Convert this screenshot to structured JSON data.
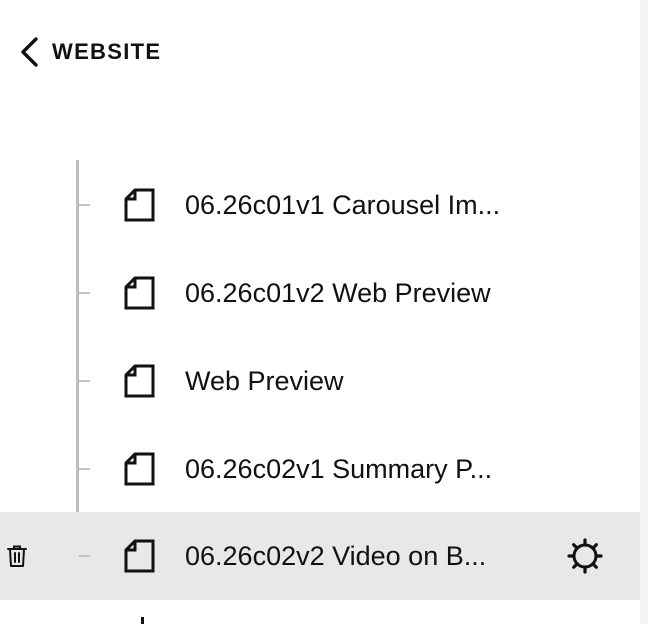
{
  "header": {
    "back_label": "WEBSITE"
  },
  "pages": [
    {
      "label": "06.26c01v1 Carousel Im..."
    },
    {
      "label": "06.26c01v2 Web Preview"
    },
    {
      "label": "Web Preview"
    },
    {
      "label": "06.26c02v1 Summary P..."
    },
    {
      "label": "06.26c02v2 Video on B...",
      "selected": true
    }
  ],
  "next_item": {
    "label": ""
  },
  "icons": {
    "back": "chevron-left-icon",
    "page": "page-icon",
    "delete": "trash-icon",
    "settings": "gear-icon"
  },
  "colors": {
    "selected_row": "#e8e8e8",
    "tree_line": "#bdbdbd",
    "text": "#111111"
  }
}
